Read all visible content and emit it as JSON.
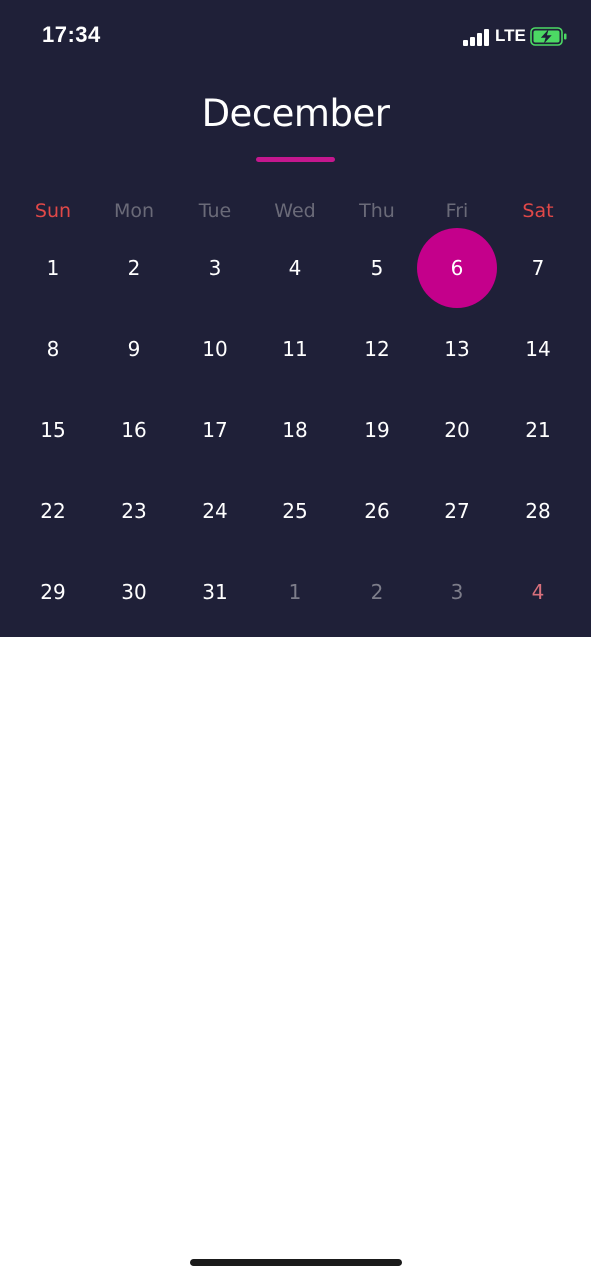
{
  "status_bar": {
    "time": "17:34",
    "network": "LTE",
    "icons": [
      "signal-icon",
      "battery-charging-icon"
    ]
  },
  "calendar": {
    "month": "December",
    "accent_color": "#c4008b",
    "weekend_color": "#e04848",
    "weekdays": [
      "Sun",
      "Mon",
      "Tue",
      "Wed",
      "Thu",
      "Fri",
      "Sat"
    ],
    "weeks": [
      [
        "1",
        "2",
        "3",
        "4",
        "5",
        "6",
        "7"
      ],
      [
        "8",
        "9",
        "10",
        "11",
        "12",
        "13",
        "14"
      ],
      [
        "15",
        "16",
        "17",
        "18",
        "19",
        "20",
        "21"
      ],
      [
        "22",
        "23",
        "24",
        "25",
        "26",
        "27",
        "28"
      ],
      [
        "29",
        "30",
        "31",
        "1",
        "2",
        "3",
        "4"
      ]
    ],
    "selected_day": "6"
  }
}
